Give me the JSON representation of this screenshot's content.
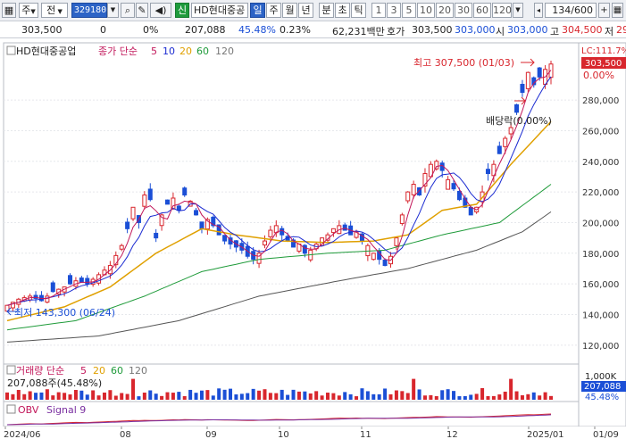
{
  "toolbar": {
    "type_label": "주",
    "mode_label": "전",
    "code": "329180",
    "stock_name": "HD현대중공",
    "credit_label": "신",
    "period_buttons": [
      "일",
      "주",
      "월",
      "년",
      "분",
      "초",
      "틱"
    ],
    "interval_buttons": [
      "1",
      "3",
      "5",
      "10",
      "20",
      "30",
      "60",
      "120"
    ],
    "counter": "134/600"
  },
  "quote": {
    "price": "303,500",
    "change": "0",
    "change_rate": "0%",
    "volume": "207,088",
    "volume_ratio": "45.48%",
    "turnover_rate": "0.23%",
    "amount": "62,231백만",
    "ask_label": "호가",
    "ask_price": "303,500",
    "bid_price": "303,000",
    "open_label": "시",
    "open_price": "303,000",
    "high_label": "고",
    "high_price": "304,500",
    "low_label": "저",
    "low_price": "29"
  },
  "price_panel": {
    "legend_name": "HD현대중공업",
    "legend_ma_label": "종가 단순",
    "ma_periods": [
      "5",
      "10",
      "20",
      "60",
      "120"
    ],
    "lc_label": "LC:111.7%",
    "current_price_tag": "303,500",
    "pct_label": "0.00%",
    "high_annotation": "최고 307,500 (01/03)",
    "low_annotation": "최저 143,300 (06/24)",
    "dividend_annotation": "배당락(0.00%)",
    "y_ticks": [
      "280,000",
      "260,000",
      "240,000",
      "220,000",
      "200,000",
      "180,000",
      "160,000",
      "140,000",
      "120,000"
    ]
  },
  "volume_panel": {
    "legend_label": "거래량 단순",
    "ma_periods": [
      "5",
      "20",
      "60",
      "120"
    ],
    "value_text": "207,088주(45.48%)",
    "y_tick": "1,000K",
    "current_tag": "207,088",
    "pct_label": "45.48%"
  },
  "obv_panel": {
    "legend_label": "OBV",
    "signal_label": "Signal 9"
  },
  "x_axis": {
    "labels": [
      "2024/06",
      "08",
      "09",
      "10",
      "11",
      "12",
      "2025/01",
      "01/09"
    ]
  },
  "colors": {
    "up": "#d8262d",
    "down": "#1b4fd6",
    "ma5": "#c2185b",
    "ma10": "#1b2bd1",
    "ma20": "#e0a000",
    "ma60": "#1f9b3a",
    "ma120": "#555555"
  },
  "chart_data": {
    "type": "candlestick",
    "title": "HD현대중공업",
    "ylim": [
      110000,
      315000
    ],
    "price_ticks": [
      120000,
      140000,
      160000,
      180000,
      200000,
      220000,
      240000,
      260000,
      280000
    ],
    "dates": [
      "2024/06",
      "08",
      "09",
      "10",
      "11",
      "12",
      "2025/01"
    ],
    "close_path": [
      [
        0,
        146000
      ],
      [
        2,
        150000
      ],
      [
        4,
        152000
      ],
      [
        6,
        149000
      ],
      [
        8,
        155000
      ],
      [
        10,
        158000
      ],
      [
        12,
        162000
      ],
      [
        14,
        160000
      ],
      [
        16,
        166000
      ],
      [
        18,
        172000
      ],
      [
        20,
        185000
      ],
      [
        21,
        196000
      ],
      [
        22,
        210000
      ],
      [
        23,
        200000
      ],
      [
        24,
        218000
      ],
      [
        25,
        215000
      ],
      [
        26,
        190000
      ],
      [
        27,
        205000
      ],
      [
        28,
        212000
      ],
      [
        29,
        216000
      ],
      [
        30,
        208000
      ],
      [
        31,
        218000
      ],
      [
        32,
        214000
      ],
      [
        33,
        205000
      ],
      [
        34,
        196000
      ],
      [
        35,
        202000
      ],
      [
        36,
        198000
      ],
      [
        37,
        192000
      ],
      [
        38,
        188000
      ],
      [
        39,
        186000
      ],
      [
        40,
        184000
      ],
      [
        41,
        182000
      ],
      [
        42,
        178000
      ],
      [
        43,
        176000
      ],
      [
        44,
        180000
      ],
      [
        45,
        188000
      ],
      [
        46,
        195000
      ],
      [
        47,
        198000
      ],
      [
        48,
        192000
      ],
      [
        49,
        188000
      ],
      [
        50,
        184000
      ],
      [
        51,
        186000
      ],
      [
        52,
        180000
      ],
      [
        53,
        182000
      ],
      [
        54,
        186000
      ],
      [
        55,
        190000
      ],
      [
        56,
        192000
      ],
      [
        57,
        196000
      ],
      [
        58,
        198000
      ],
      [
        59,
        195000
      ],
      [
        60,
        192000
      ],
      [
        61,
        194000
      ],
      [
        62,
        188000
      ],
      [
        63,
        185000
      ],
      [
        64,
        180000
      ],
      [
        65,
        176000
      ],
      [
        66,
        172000
      ],
      [
        67,
        178000
      ],
      [
        68,
        190000
      ],
      [
        69,
        205000
      ],
      [
        70,
        220000
      ],
      [
        71,
        225000
      ],
      [
        72,
        218000
      ],
      [
        73,
        232000
      ],
      [
        74,
        238000
      ],
      [
        75,
        240000
      ],
      [
        76,
        234000
      ],
      [
        77,
        228000
      ],
      [
        78,
        222000
      ],
      [
        79,
        215000
      ],
      [
        80,
        210000
      ],
      [
        81,
        205000
      ],
      [
        82,
        210000
      ],
      [
        83,
        220000
      ],
      [
        84,
        232000
      ],
      [
        85,
        238000
      ],
      [
        86,
        245000
      ],
      [
        87,
        255000
      ],
      [
        88,
        262000
      ],
      [
        89,
        272000
      ],
      [
        90,
        285000
      ],
      [
        91,
        298000
      ],
      [
        92,
        290000
      ],
      [
        93,
        295000
      ],
      [
        94,
        300000
      ],
      [
        95,
        303500
      ]
    ],
    "ma20_path": [
      [
        0,
        136000
      ],
      [
        10,
        145000
      ],
      [
        18,
        158000
      ],
      [
        26,
        180000
      ],
      [
        34,
        196000
      ],
      [
        40,
        192000
      ],
      [
        48,
        188000
      ],
      [
        56,
        187000
      ],
      [
        64,
        188000
      ],
      [
        70,
        192000
      ],
      [
        76,
        208000
      ],
      [
        82,
        212000
      ],
      [
        88,
        238000
      ],
      [
        95,
        266000
      ]
    ],
    "ma60_path": [
      [
        0,
        130000
      ],
      [
        12,
        136000
      ],
      [
        24,
        152000
      ],
      [
        34,
        168000
      ],
      [
        44,
        176000
      ],
      [
        56,
        180000
      ],
      [
        66,
        182000
      ],
      [
        76,
        192000
      ],
      [
        86,
        200000
      ],
      [
        95,
        225000
      ]
    ],
    "ma120_path": [
      [
        0,
        122000
      ],
      [
        16,
        126000
      ],
      [
        30,
        136000
      ],
      [
        44,
        152000
      ],
      [
        58,
        162000
      ],
      [
        70,
        170000
      ],
      [
        82,
        182000
      ],
      [
        90,
        194000
      ],
      [
        95,
        207000
      ]
    ],
    "volume_ylim": [
      0,
      1000000
    ],
    "volume_last": 207088
  }
}
